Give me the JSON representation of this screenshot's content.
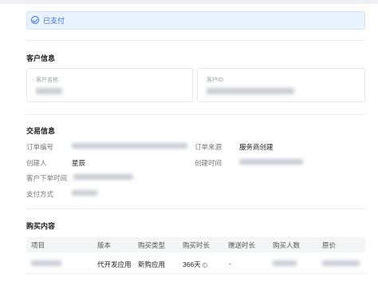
{
  "status": {
    "text": "已支付",
    "color": "#2f6fe0",
    "icon": "check-circle-icon"
  },
  "customer_section": {
    "title": "客户信息",
    "name_label": "客户名称",
    "id_label": "客户ID"
  },
  "transaction_section": {
    "title": "交易信息",
    "order_no_label": "订单编号",
    "order_source_label": "订单来源",
    "order_source_value": "服务商创建",
    "creator_label": "创建人",
    "creator_value": "星辰",
    "created_time_label": "创建时间",
    "customer_order_time_label": "客户下单时间",
    "payment_method_label": "支付方式"
  },
  "purchase_section": {
    "title": "购买内容",
    "columns": [
      "项目",
      "版本",
      "购买类型",
      "购买时长",
      "赠送时长",
      "购买人数",
      "原价"
    ],
    "row": {
      "version": "代开发应用",
      "purchase_type": "新购应用",
      "duration": "366天",
      "gift_duration": "-"
    }
  }
}
